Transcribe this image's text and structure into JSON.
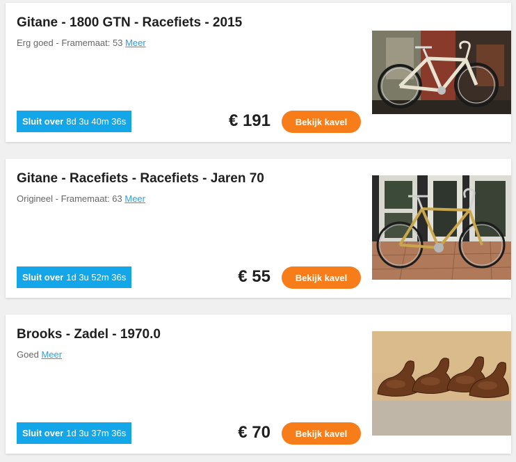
{
  "listings": [
    {
      "title": "Gitane - 1800 GTN - Racefiets - 2015",
      "condition": "Erg goed - Framemaat: 53",
      "more_link": "Meer",
      "closes_label": "Sluit over",
      "closes_value": "8d 3u 40m 36s",
      "price": "€ 191",
      "button": "Bekijk kavel",
      "image": "racing-bike-photo"
    },
    {
      "title": "Gitane - Racefiets - Racefiets - Jaren 70",
      "condition": "Origineel - Framemaat: 63",
      "more_link": "Meer",
      "closes_label": "Sluit over",
      "closes_value": "1d 3u 52m 36s",
      "price": "€ 55",
      "button": "Bekijk kavel",
      "image": "vintage-bike-photo"
    },
    {
      "title": "Brooks - Zadel - 1970.0",
      "condition": "Goed",
      "more_link": "Meer",
      "closes_label": "Sluit over",
      "closes_value": "1d 3u 37m 36s",
      "price": "€ 70",
      "button": "Bekijk kavel",
      "image": "saddles-photo"
    }
  ],
  "colors": {
    "badge": "#13a6e8",
    "button": "#f77d1a",
    "link": "#2a9ddf"
  }
}
